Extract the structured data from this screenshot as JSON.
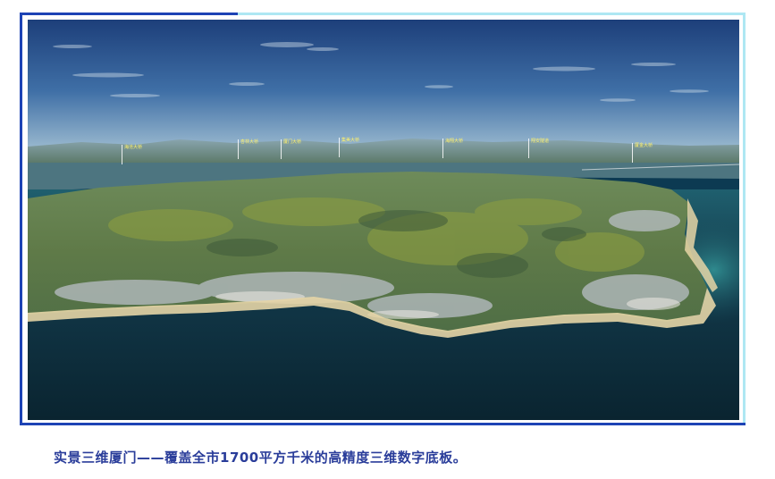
{
  "caption": {
    "text": "实景三维厦门——覆盖全市1700平方千米的高精度三维数字底板。"
  },
  "colors": {
    "frame_light": "#aee7f3",
    "frame_dark": "#1d43b5",
    "caption_text": "#2a3d9a",
    "label_text": "#fff16a"
  },
  "photo": {
    "description_icon": "aerial-3d-city-model-image",
    "labels": [
      {
        "name": "海沧大桥"
      },
      {
        "name": "杏林大桥"
      },
      {
        "name": "厦门大桥"
      },
      {
        "name": "集美大桥"
      },
      {
        "name": "海翔大桥"
      },
      {
        "name": "翔安隧道"
      },
      {
        "name": "厦金大桥"
      }
    ]
  }
}
